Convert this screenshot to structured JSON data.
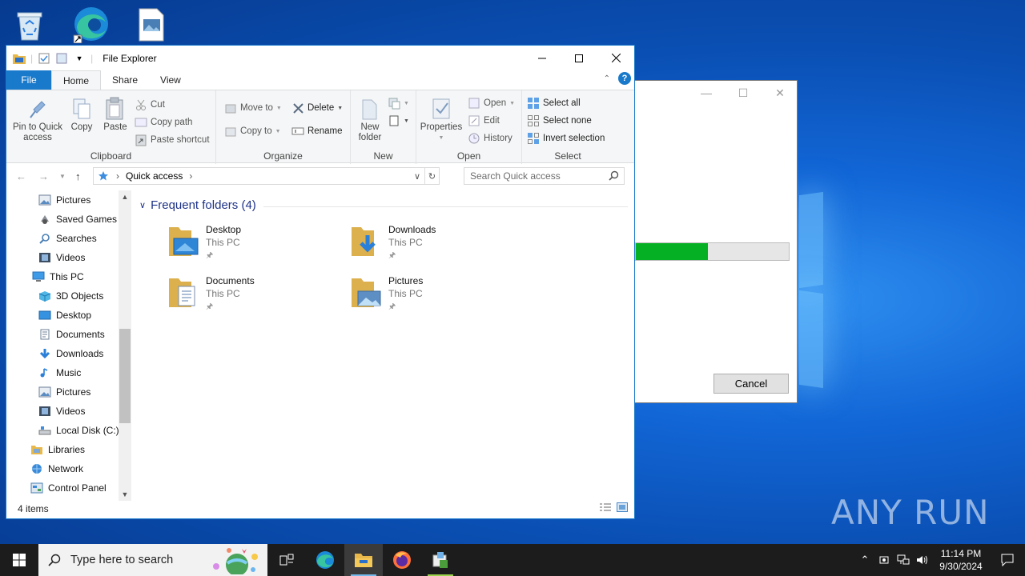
{
  "explorer": {
    "title": "File Explorer",
    "tabs": [
      "File",
      "Home",
      "Share",
      "View"
    ],
    "help_label": "?",
    "ribbon": {
      "clipboard": {
        "label": "Clipboard",
        "pin": "Pin to Quick access",
        "copy": "Copy",
        "paste": "Paste",
        "cut": "Cut",
        "copy_path": "Copy path",
        "paste_shortcut": "Paste shortcut"
      },
      "organize": {
        "label": "Organize",
        "move_to": "Move to",
        "copy_to": "Copy to",
        "delete": "Delete",
        "rename": "Rename"
      },
      "new": {
        "label": "New",
        "new_folder": "New folder"
      },
      "open": {
        "label": "Open",
        "properties": "Properties",
        "open": "Open",
        "edit": "Edit",
        "history": "History"
      },
      "select": {
        "label": "Select",
        "select_all": "Select all",
        "select_none": "Select none",
        "invert": "Invert selection"
      }
    },
    "address": {
      "crumb": "Quick access"
    },
    "search": {
      "placeholder": "Search Quick access"
    },
    "nav_items": [
      {
        "label": "Pictures",
        "icon": "pictures-icon"
      },
      {
        "label": "Saved Games",
        "icon": "saved-games-icon"
      },
      {
        "label": "Searches",
        "icon": "searches-icon"
      },
      {
        "label": "Videos",
        "icon": "videos-icon"
      },
      {
        "label": "This PC",
        "icon": "this-pc-icon"
      },
      {
        "label": "3D Objects",
        "icon": "3d-objects-icon"
      },
      {
        "label": "Desktop",
        "icon": "desktop-icon"
      },
      {
        "label": "Documents",
        "icon": "documents-icon"
      },
      {
        "label": "Downloads",
        "icon": "downloads-icon"
      },
      {
        "label": "Music",
        "icon": "music-icon"
      },
      {
        "label": "Pictures",
        "icon": "pictures-icon"
      },
      {
        "label": "Videos",
        "icon": "videos-icon"
      },
      {
        "label": "Local Disk (C:)",
        "icon": "drive-icon"
      },
      {
        "label": "Libraries",
        "icon": "libraries-icon"
      },
      {
        "label": "Network",
        "icon": "network-icon"
      },
      {
        "label": "Control Panel",
        "icon": "control-panel-icon"
      }
    ],
    "section_title": "Frequent folders (4)",
    "folders": [
      {
        "name": "Desktop",
        "location": "This PC"
      },
      {
        "name": "Downloads",
        "location": "This PC"
      },
      {
        "name": "Documents",
        "location": "This PC"
      },
      {
        "name": "Pictures",
        "location": "This PC"
      }
    ],
    "status": "4 items"
  },
  "dialog": {
    "progress_fraction": 0.47,
    "cancel_label": "Cancel"
  },
  "taskbar": {
    "search_placeholder": "Type here to search",
    "time": "11:14 PM",
    "date": "9/30/2024"
  },
  "watermark": "ANY RUN",
  "colors": {
    "accent": "#1979ca",
    "progress": "#06b025",
    "section_title": "#1e3287",
    "taskbar": "#1c1c1c"
  }
}
